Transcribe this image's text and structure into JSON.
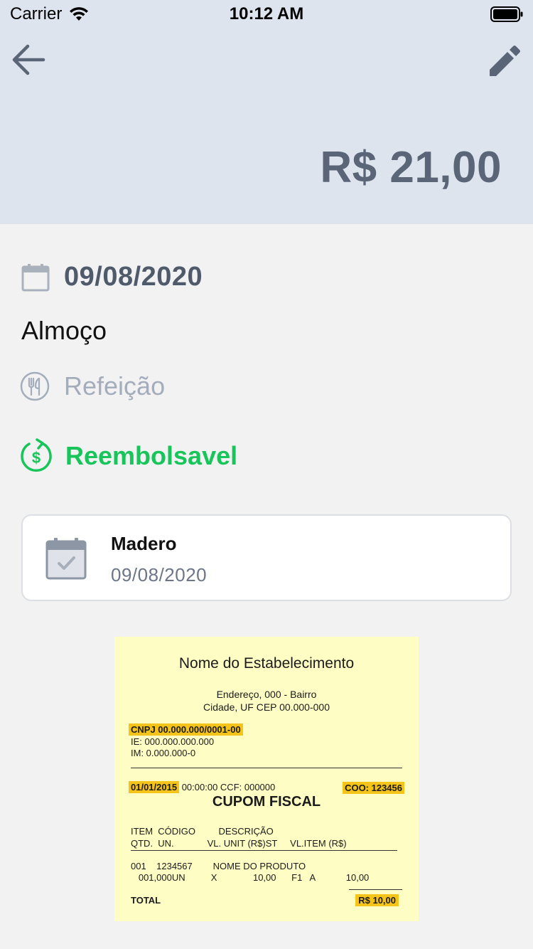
{
  "status_bar": {
    "carrier": "Carrier",
    "time": "10:12 AM"
  },
  "header": {
    "amount": "R$ 21,00",
    "background": "#dde4ee"
  },
  "expense": {
    "date": "09/08/2020",
    "title": "Almoço",
    "category": "Refeição",
    "reimbursable_label": "Reembolsavel",
    "accent_color": "#17c55a"
  },
  "report_card": {
    "name": "Madero",
    "date": "09/08/2020"
  },
  "receipt": {
    "establishment": "Nome do Estabelecimento",
    "address_line1": "Endereço, 000 - Bairro",
    "address_line2": "Cidade, UF CEP 00.000-000",
    "cnpj": "CNPJ 00.000.000/0001-00",
    "ie": "IE: 000.000.000.000",
    "im": "IM: 0.000.000-0",
    "date": "01/01/2015",
    "time_ccf": "00:00:00 CCF: 000000",
    "coo": "COO: 123456",
    "heading": "CUPOM FISCAL",
    "col_row1": "ITEM  CÓDIGO         DESCRIÇÃO",
    "col_row2": "QTD.  UN.             VL. UNIT (R$)ST     VL.ITEM (R$)",
    "item_row1": "001    1234567        NOME DO PRODUTO",
    "item_row2": "   001,000UN          X              10,00      F1   A            10,00",
    "total_label": "TOTAL",
    "total_value": "R$ 10,00"
  }
}
